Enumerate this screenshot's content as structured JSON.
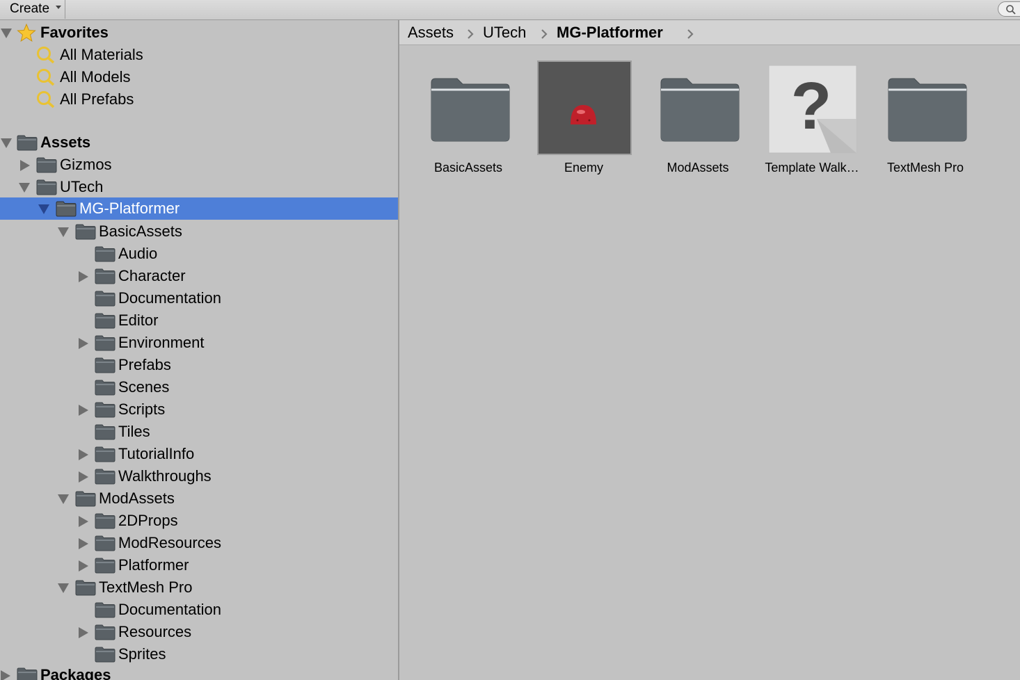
{
  "toolbar": {
    "create_label": "Create",
    "search_icon": "search-icon"
  },
  "tree": {
    "favorites": {
      "label": "Favorites",
      "items": [
        "All Materials",
        "All Models",
        "All Prefabs"
      ]
    },
    "rows": [
      {
        "label": "Assets",
        "bold": true,
        "arrow": "down"
      },
      {
        "label": "Gizmos",
        "arrow": "right"
      },
      {
        "label": "UTech",
        "arrow": "down"
      },
      {
        "label": "MG-Platformer",
        "arrow": "down",
        "selected": true
      },
      {
        "label": "BasicAssets",
        "arrow": "down"
      },
      {
        "label": "Audio",
        "arrow": "none"
      },
      {
        "label": "Character",
        "arrow": "right"
      },
      {
        "label": "Documentation",
        "arrow": "none"
      },
      {
        "label": "Editor",
        "arrow": "none"
      },
      {
        "label": "Environment",
        "arrow": "right"
      },
      {
        "label": "Prefabs",
        "arrow": "none"
      },
      {
        "label": "Scenes",
        "arrow": "none"
      },
      {
        "label": "Scripts",
        "arrow": "right"
      },
      {
        "label": "Tiles",
        "arrow": "none"
      },
      {
        "label": "TutorialInfo",
        "arrow": "right"
      },
      {
        "label": "Walkthroughs",
        "arrow": "right"
      },
      {
        "label": "ModAssets",
        "arrow": "down"
      },
      {
        "label": "2DProps",
        "arrow": "right"
      },
      {
        "label": "ModResources",
        "arrow": "right"
      },
      {
        "label": "Platformer",
        "arrow": "right"
      },
      {
        "label": "TextMesh Pro",
        "arrow": "down"
      },
      {
        "label": "Documentation",
        "arrow": "none"
      },
      {
        "label": "Resources",
        "arrow": "right"
      },
      {
        "label": "Sprites",
        "arrow": "none"
      },
      {
        "label": "Packages",
        "bold": true,
        "arrow": "right"
      }
    ]
  },
  "breadcrumb": [
    "Assets",
    "UTech",
    "MG-Platformer"
  ],
  "grid": [
    {
      "name": "BasicAssets",
      "kind": "folder"
    },
    {
      "name": "Enemy",
      "kind": "prefab"
    },
    {
      "name": "ModAssets",
      "kind": "folder"
    },
    {
      "name": "Template Walk…",
      "kind": "unknown"
    },
    {
      "name": "TextMesh Pro",
      "kind": "folder"
    }
  ],
  "colors": {
    "selection": "#4e7fd8",
    "panel": "#c2c2c2",
    "folder": "#5a6166"
  }
}
